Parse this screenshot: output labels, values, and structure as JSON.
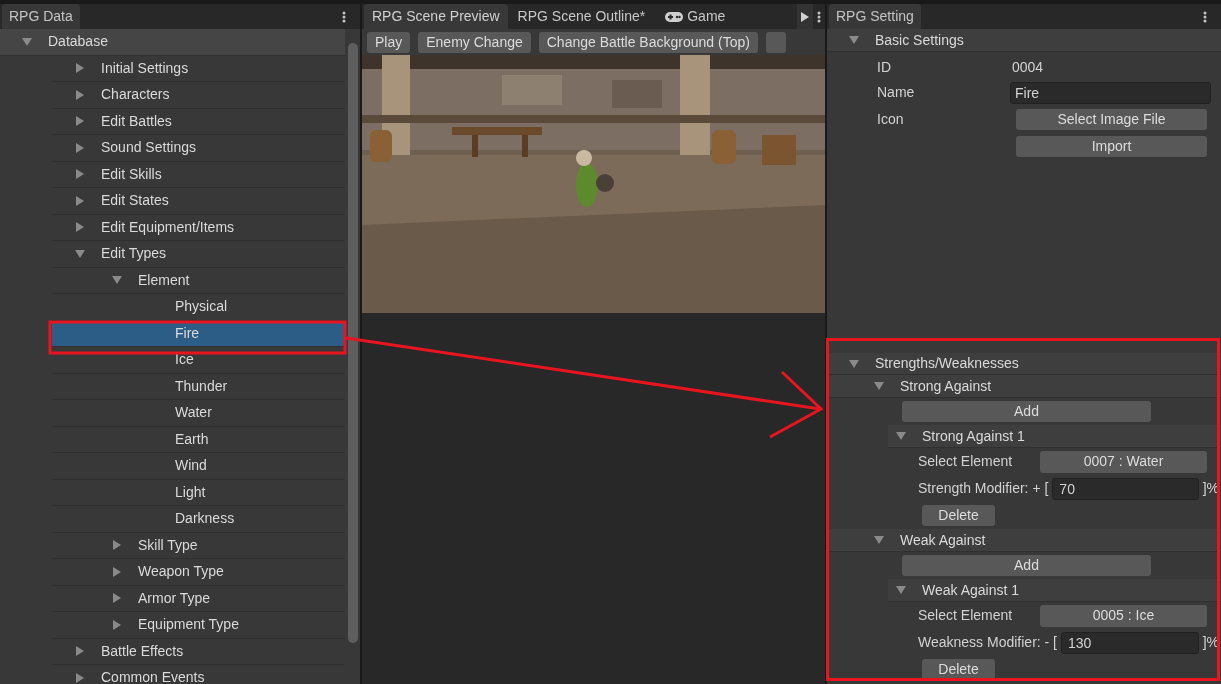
{
  "left_panel": {
    "tab": "RPG Data",
    "tree": [
      {
        "label": "Database",
        "expanded": true,
        "selected": false,
        "children": [
          {
            "label": "Initial Settings",
            "expanded": false,
            "selected": false
          },
          {
            "label": "Characters",
            "expanded": false,
            "selected": false
          },
          {
            "label": "Edit Battles",
            "expanded": false,
            "selected": false
          },
          {
            "label": "Sound Settings",
            "expanded": false,
            "selected": false
          },
          {
            "label": "Edit Skills",
            "expanded": false,
            "selected": false
          },
          {
            "label": "Edit States",
            "expanded": false,
            "selected": false
          },
          {
            "label": "Edit Equipment/Items",
            "expanded": false,
            "selected": false
          },
          {
            "label": "Edit Types",
            "expanded": true,
            "selected": false,
            "children": [
              {
                "label": "Element",
                "expanded": true,
                "selected": false,
                "children": [
                  {
                    "label": "Physical",
                    "selected": false
                  },
                  {
                    "label": "Fire",
                    "selected": true
                  },
                  {
                    "label": "Ice",
                    "selected": false
                  },
                  {
                    "label": "Thunder",
                    "selected": false
                  },
                  {
                    "label": "Water",
                    "selected": false
                  },
                  {
                    "label": "Earth",
                    "selected": false
                  },
                  {
                    "label": "Wind",
                    "selected": false
                  },
                  {
                    "label": "Light",
                    "selected": false
                  },
                  {
                    "label": "Darkness",
                    "selected": false
                  }
                ]
              },
              {
                "label": "Skill Type",
                "expanded": false,
                "selected": false
              },
              {
                "label": "Weapon Type",
                "expanded": false,
                "selected": false
              },
              {
                "label": "Armor Type",
                "expanded": false,
                "selected": false
              },
              {
                "label": "Equipment Type",
                "expanded": false,
                "selected": false
              }
            ]
          },
          {
            "label": "Battle Effects",
            "expanded": false,
            "selected": false
          },
          {
            "label": "Common Events",
            "expanded": false,
            "selected": false
          }
        ]
      }
    ]
  },
  "center_panel": {
    "tabs": [
      {
        "label": "RPG Scene Preview",
        "selected": true,
        "kind": "plain"
      },
      {
        "label": "RPG Scene Outline*",
        "selected": false,
        "kind": "plain"
      },
      {
        "label": "Game",
        "selected": false,
        "kind": "game"
      }
    ],
    "toolbar": [
      "Play",
      "Enemy Change",
      "Change Battle Background (Top)"
    ]
  },
  "right_panel": {
    "tab": "RPG Setting",
    "basic_settings": {
      "title": "Basic Settings",
      "expanded": true,
      "id_label": "ID",
      "id_value": "0004",
      "name_label": "Name",
      "name_value": "Fire",
      "icon_label": "Icon",
      "buttons": [
        "Select Image File",
        "Import"
      ]
    },
    "strengths_weaknesses": {
      "title": "Strengths/Weaknesses",
      "expanded": true,
      "groups": [
        {
          "title": "Strong Against",
          "expanded": true,
          "add_button": "Add",
          "entries": [
            {
              "title": "Strong Against 1",
              "expanded": true,
              "select_label": "Select Element",
              "select_value": "0007 : Water",
              "modifier_label": "Strength Modifier: + [",
              "modifier_value": "70",
              "modifier_suffix": "]%",
              "delete_button": "Delete"
            }
          ]
        },
        {
          "title": "Weak Against",
          "expanded": true,
          "add_button": "Add",
          "entries": [
            {
              "title": "Weak Against 1",
              "expanded": true,
              "select_label": "Select Element",
              "select_value": "0005 : Ice",
              "modifier_label": "Weakness Modifier: - [",
              "modifier_value": "130",
              "modifier_suffix": "]%",
              "delete_button": "Delete"
            }
          ]
        }
      ]
    }
  }
}
